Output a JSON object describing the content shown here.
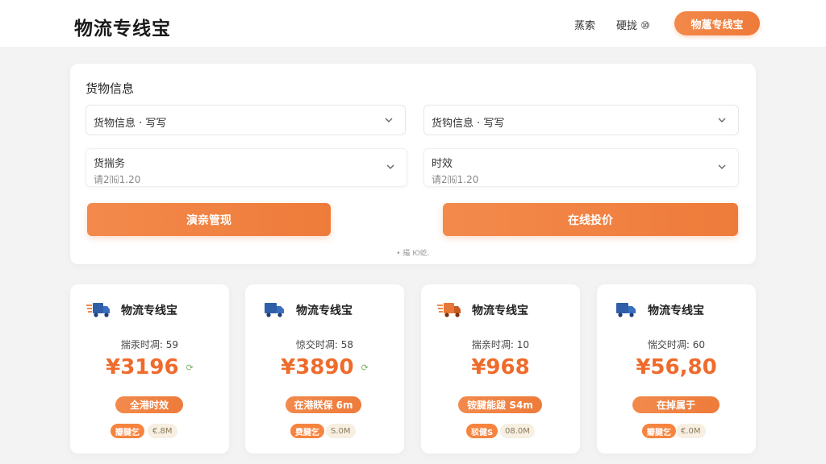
{
  "header": {
    "logo": "物流专线宝",
    "nav": [
      "蒸索",
      "硬拢 ⑩"
    ],
    "cta": "物蔰专线宝"
  },
  "form": {
    "title": "货物信息",
    "fields": [
      {
        "label": "货物信息 · 写写"
      },
      {
        "label": "货钩信息 · 写写"
      },
      {
        "label": "货揣务",
        "sub": "请2⒃1.20"
      },
      {
        "label": "时效",
        "sub": "请2⒃1.20"
      }
    ],
    "buttons": [
      "演亲管现",
      "在线投价"
    ],
    "footnote": "• 撮 Ю虼."
  },
  "colors": {
    "accent": "#ef7b3a",
    "price": "#ef6b2c",
    "truck_blue": "#2f5fa8"
  },
  "cards": [
    {
      "icon": "fast-truck-icon",
      "name": "物流专线宝",
      "eta": "揣汞时凋: 59",
      "price": "¥3196",
      "refresh": "⟳",
      "badge": "全港时效",
      "tag": "瓣腱乞",
      "tag2": "€.8M"
    },
    {
      "icon": "truck-icon",
      "name": "物流专线宝",
      "eta": "惊交时凋: 58",
      "price": "¥3890",
      "refresh": "⟳",
      "badge": "在港眹保 6m",
      "tag": "费腱乞",
      "tag2": "S.0M"
    },
    {
      "icon": "fast-truck-icon",
      "name": "物流专线宝",
      "eta": "揣亲时凋: 10",
      "price": "¥968",
      "refresh": "",
      "badge": "铵腱能跋 S4m",
      "tag": "驳健S",
      "tag2": "08.0M"
    },
    {
      "icon": "truck-icon",
      "name": "物流专线宝",
      "eta": "惴交时凋: 60",
      "price": "¥56,80",
      "refresh": "",
      "badge": "在掉属于",
      "tag": "瓣腱乞",
      "tag2": "€.0M"
    }
  ]
}
